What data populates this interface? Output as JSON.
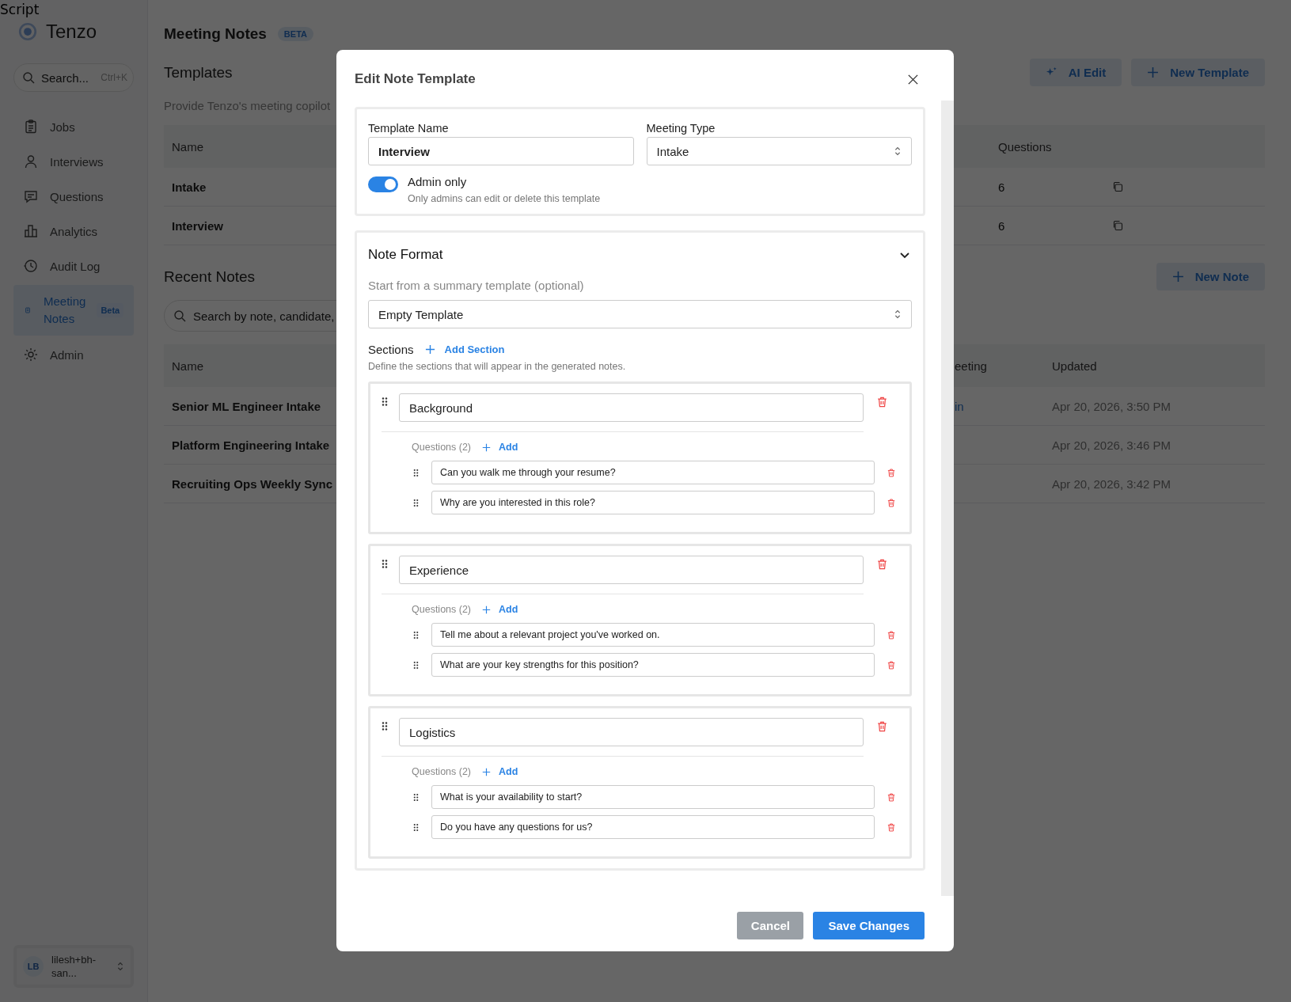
{
  "top_text": "Script",
  "sidebar": {
    "brand": "Tenzo",
    "search": {
      "placeholder": "Search...",
      "shortcut": "Ctrl+K"
    },
    "items": [
      {
        "label": "Jobs",
        "selected": false
      },
      {
        "label": "Interviews",
        "selected": false
      },
      {
        "label": "Questions",
        "selected": false
      },
      {
        "label": "Analytics",
        "selected": false
      },
      {
        "label": "Audit Log",
        "selected": false
      },
      {
        "label": "Meeting Notes",
        "badge": "Beta",
        "selected": true
      },
      {
        "label": "Admin",
        "selected": false
      }
    ],
    "user": {
      "initials": "LB",
      "name": "lilesh+bh-san..."
    }
  },
  "header": {
    "title": "Meeting Notes",
    "badge": "BETA"
  },
  "templates": {
    "title": "Templates",
    "description": "Provide Tenzo's meeting copilot",
    "buttons": [
      {
        "label": "AI Edit",
        "kind": "ai"
      },
      {
        "label": "New Template",
        "kind": "add"
      }
    ],
    "columns": [
      "Name",
      "Questions"
    ],
    "rows": [
      {
        "name": "Intake",
        "questions": "6"
      },
      {
        "name": "Interview",
        "questions": "6"
      }
    ]
  },
  "recent_notes": {
    "title": "Recent Notes",
    "search": {
      "placeholder": "Search by note, candidate,"
    },
    "new_button": "New Note",
    "columns": [
      "Name",
      "eeting",
      "Updated"
    ],
    "rows": [
      {
        "name": "Senior ML Engineer Intake",
        "meeting": "in",
        "updated": "Apr 20, 2026, 3:50 PM"
      },
      {
        "name": "Platform Engineering Intake",
        "updated": "Apr 20, 2026, 3:46 PM"
      },
      {
        "name": "Recruiting Ops Weekly Sync",
        "updated": "Apr 20, 2026, 3:42 PM"
      }
    ]
  },
  "modal": {
    "title": "Edit Note Template",
    "template_name": {
      "label": "Template Name",
      "value": "Interview"
    },
    "meeting_type": {
      "label": "Meeting Type",
      "value": "Intake"
    },
    "admin_only": {
      "label": "Admin only",
      "hint": "Only admins can edit or delete this template",
      "on": true
    },
    "note_format": {
      "title": "Note Format",
      "expanded": true,
      "summary_label": "Start from a summary template (optional)",
      "summary_value": "Empty Template",
      "sections_label": "Sections",
      "add_section": "Add Section",
      "sections_hint": "Define the sections that will appear in the generated notes.",
      "sections": [
        {
          "title": "Background",
          "questions_label": "Questions (2)",
          "add": "Add",
          "questions": [
            "Can you walk me through your resume?",
            "Why are you interested in this role?"
          ]
        },
        {
          "title": "Experience",
          "questions_label": "Questions (2)",
          "add": "Add",
          "questions": [
            "Tell me about a relevant project you've worked on.",
            "What are your key strengths for this position?"
          ]
        },
        {
          "title": "Logistics",
          "questions_label": "Questions (2)",
          "add": "Add",
          "questions": [
            "What is your availability to start?",
            "Do you have any questions for us?"
          ]
        }
      ]
    },
    "buttons": {
      "cancel": "Cancel",
      "save": "Save Changes"
    }
  }
}
